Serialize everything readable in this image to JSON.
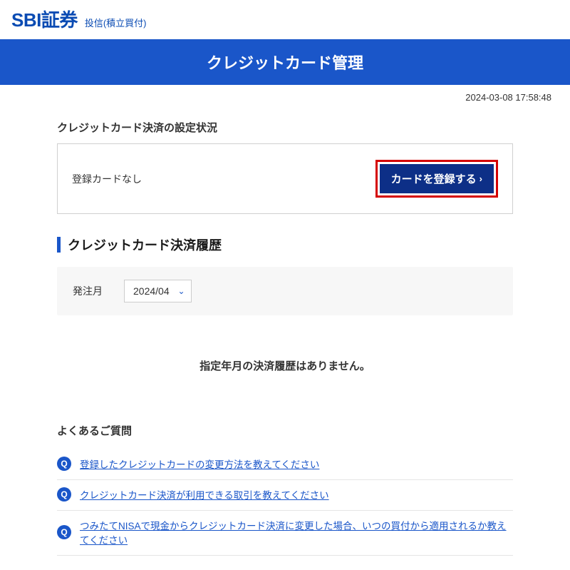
{
  "header": {
    "logo": "SBI証券",
    "logo_sub": "投信(積立買付)"
  },
  "title_bar": "クレジットカード管理",
  "timestamp": "2024-03-08 17:58:48",
  "status": {
    "section_title": "クレジットカード決済の設定状況",
    "text": "登録カードなし",
    "register_button": "カードを登録する"
  },
  "history": {
    "heading": "クレジットカード決済履歴",
    "filter_label": "発注月",
    "selected_month": "2024/04",
    "no_history_msg": "指定年月の決済履歴はありません。"
  },
  "faq": {
    "heading": "よくあるご質問",
    "items": [
      "登録したクレジットカードの変更方法を教えてください",
      "クレジットカード決済が利用できる取引を教えてください",
      "つみたてNISAで現金からクレジットカード決済に変更した場合、いつの買付から適用されるか教えてください"
    ]
  }
}
